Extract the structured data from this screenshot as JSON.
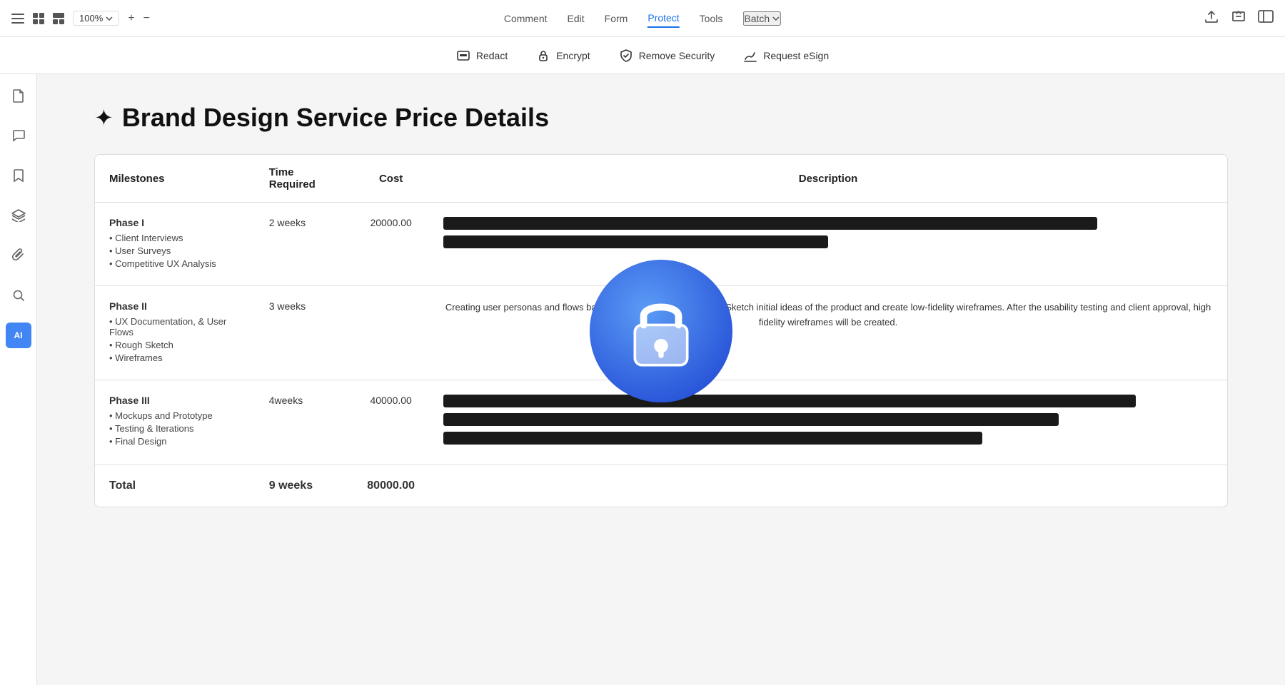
{
  "topnav": {
    "zoom": "100%",
    "menu_items": [
      "Comment",
      "Edit",
      "Form",
      "Protect",
      "Tools",
      "Batch"
    ],
    "active_item": "Protect",
    "batch_label": "Batch"
  },
  "toolbar": {
    "items": [
      {
        "id": "redact",
        "label": "Redact",
        "icon": "redact-icon"
      },
      {
        "id": "encrypt",
        "label": "Encrypt",
        "icon": "lock-icon"
      },
      {
        "id": "remove-security",
        "label": "Remove Security",
        "icon": "shield-icon"
      },
      {
        "id": "request-esign",
        "label": "Request eSign",
        "icon": "esign-icon"
      }
    ]
  },
  "sidebar": {
    "items": [
      {
        "id": "document",
        "icon": "doc-icon",
        "active": false
      },
      {
        "id": "comment",
        "icon": "comment-icon",
        "active": false
      },
      {
        "id": "bookmark",
        "icon": "bookmark-icon",
        "active": false
      },
      {
        "id": "layers",
        "icon": "layers-icon",
        "active": false
      },
      {
        "id": "attachment",
        "icon": "attachment-icon",
        "active": false
      },
      {
        "id": "search",
        "icon": "search-icon",
        "active": false
      },
      {
        "id": "ai",
        "label": "AI",
        "active": true
      }
    ]
  },
  "page": {
    "title": "Brand Design Service Price Details",
    "table": {
      "headers": [
        "Milestones",
        "Time Required",
        "Cost",
        "Description"
      ],
      "rows": [
        {
          "phase": "Phase I",
          "items": [
            "Client Interviews",
            "User Surveys",
            "Competitive UX Analysis"
          ],
          "time": "2 weeks",
          "cost": "20000.00",
          "desc_redacted": true,
          "desc_bars": [
            85,
            50
          ]
        },
        {
          "phase": "Phase II",
          "items": [
            "UX Documentation, & User Flows",
            "Rough Sketch",
            "Wireframes"
          ],
          "time": "3 weeks",
          "cost": "",
          "desc_text": "Creating user personas and flows based on the UX Documentation. Sketch initial ideas of the product and create low-fidelity wireframes. After the usability testing and client approval, high fidelity wireframes will be created.",
          "has_lock": true
        },
        {
          "phase": "Phase III",
          "items": [
            "Mockups and Prototype",
            "Testing & Iterations",
            "Final Design"
          ],
          "time": "4weeks",
          "cost": "40000.00",
          "desc_redacted": true,
          "desc_bars": [
            90,
            80,
            70
          ]
        }
      ],
      "total": {
        "label": "Total",
        "time": "9 weeks",
        "cost": "80000.00"
      }
    }
  }
}
